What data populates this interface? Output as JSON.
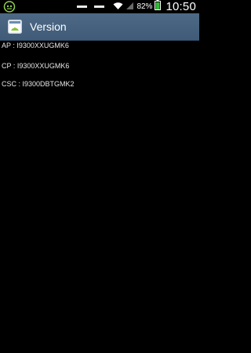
{
  "status_bar": {
    "battery_percent": "82%",
    "time": "10:50",
    "icons": [
      "game-controller-icon",
      "notification-icon",
      "notification-icon",
      "wifi-icon",
      "signal-icon",
      "battery-icon"
    ]
  },
  "action_bar": {
    "title": "Version",
    "app_icon": "android-settings-icon"
  },
  "versions": {
    "ap": "AP : I9300XXUGMK6",
    "cp": "CP : I9300XXUGMK6",
    "csc": "CSC : I9300DBTGMK2"
  },
  "colors": {
    "background": "#000000",
    "action_bar": "#45617e",
    "battery_fill": "#36b83a",
    "text": "#e6e6e6"
  }
}
